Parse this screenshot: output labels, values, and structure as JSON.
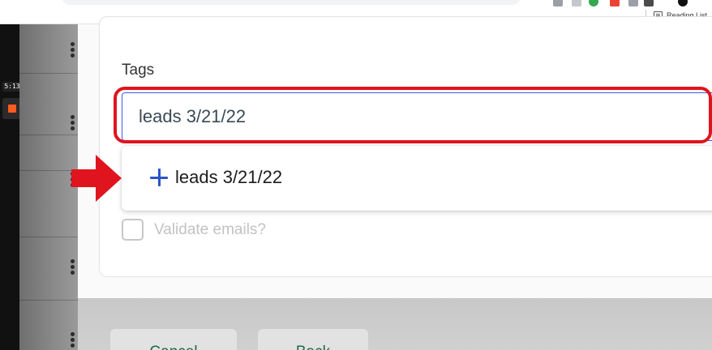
{
  "browser": {
    "reading_list_label": "Reading List"
  },
  "recorder": {
    "timer": "5:13"
  },
  "form": {
    "tags_label": "Tags",
    "tags_input_value": "leads 3/21/22",
    "suggestion": {
      "icon": "plus-icon",
      "text": "leads 3/21/22"
    },
    "validate_label": "Validate emails?",
    "validate_checked": false
  },
  "footer": {
    "cancel_label": "Cancel",
    "back_label": "Back"
  },
  "colors": {
    "highlight": "#e0141e",
    "accent_blue": "#2b55c7",
    "button_text": "#1f6b4a"
  }
}
